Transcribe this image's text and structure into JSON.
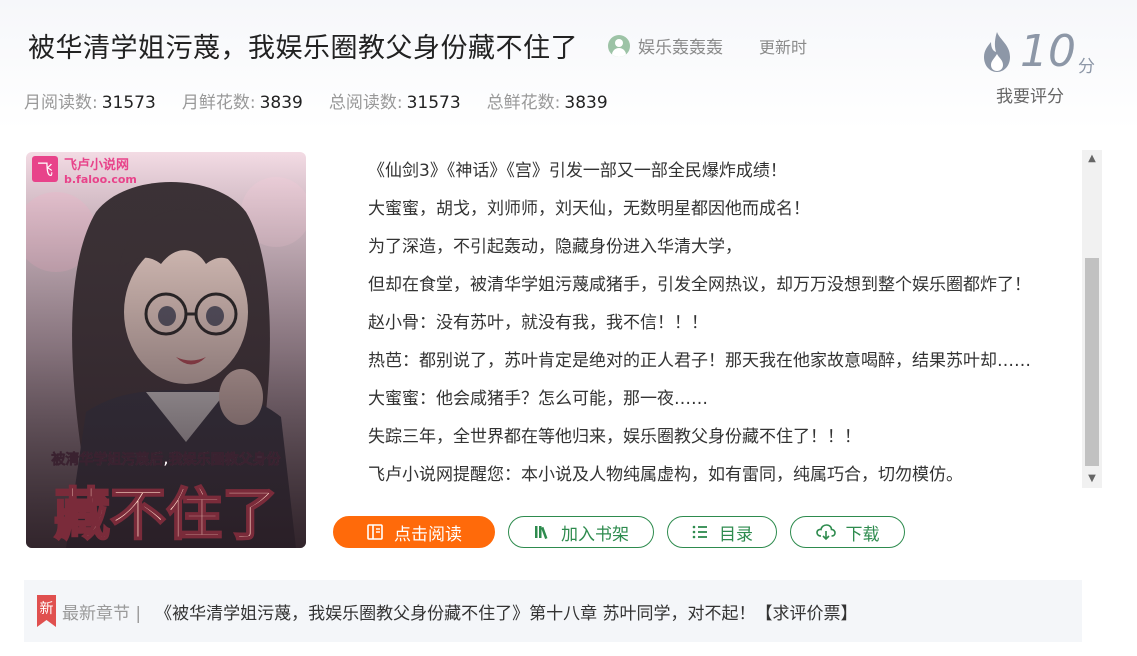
{
  "book": {
    "title": "被华清学姐污蔑，我娱乐圈教父身份藏不住了",
    "author": "娱乐轰轰轰",
    "update_label": "更新时"
  },
  "stats": [
    {
      "label": "月阅读数:",
      "value": "31573"
    },
    {
      "label": "月鲜花数:",
      "value": "3839"
    },
    {
      "label": "总阅读数:",
      "value": "31573"
    },
    {
      "label": "总鲜花数:",
      "value": "3839"
    }
  ],
  "score": {
    "value": "10",
    "unit": "分",
    "rate_label": "我要评分"
  },
  "cover": {
    "site_name": "飞卢小说网",
    "site_url": "b.faloo.com",
    "tagline": "被清华学姐污蔑后,我娱乐圈教父身份",
    "big_title": "藏不住了",
    "logo_char": "飞"
  },
  "description": [
    "《仙剑3》《神话》《宫》引发一部又一部全民爆炸成绩！",
    "大蜜蜜，胡戈，刘师师，刘天仙，无数明星都因他而成名！",
    "为了深造，不引起轰动，隐藏身份进入华清大学，",
    "但却在食堂，被清华学姐污蔑咸猪手，引发全网热议，却万万没想到整个娱乐圈都炸了！",
    "赵小骨：没有苏叶，就没有我，我不信！！！",
    "热芭：都别说了，苏叶肯定是绝对的正人君子！那天我在他家故意喝醉，结果苏叶却……",
    "大蜜蜜：他会咸猪手？怎么可能，那一夜……",
    "失踪三年，全世界都在等他归来，娱乐圈教父身份藏不住了！！！",
    "飞卢小说网提醒您：本小说及人物纯属虚构，如有雷同，纯属巧合，切勿模仿。"
  ],
  "buttons": {
    "read": "点击阅读",
    "shelf": "加入书架",
    "toc": "目录",
    "download": "下载"
  },
  "latest": {
    "tag": "新",
    "label": "最新章节 |",
    "chapter": "《被华清学姐污蔑，我娱乐圈教父身份藏不住了》第十八章 苏叶同学，对不起！【求评价票】"
  },
  "colors": {
    "accent_orange": "#ff6a0a",
    "accent_green": "#2e8b4e",
    "score_gray": "#8d97a7",
    "new_tag_red": "#e0504f"
  },
  "icons": [
    "user-avatar-icon",
    "flame-icon",
    "book-open-icon",
    "bookshelf-icon",
    "list-icon",
    "cloud-download-icon",
    "new-tag-icon"
  ]
}
